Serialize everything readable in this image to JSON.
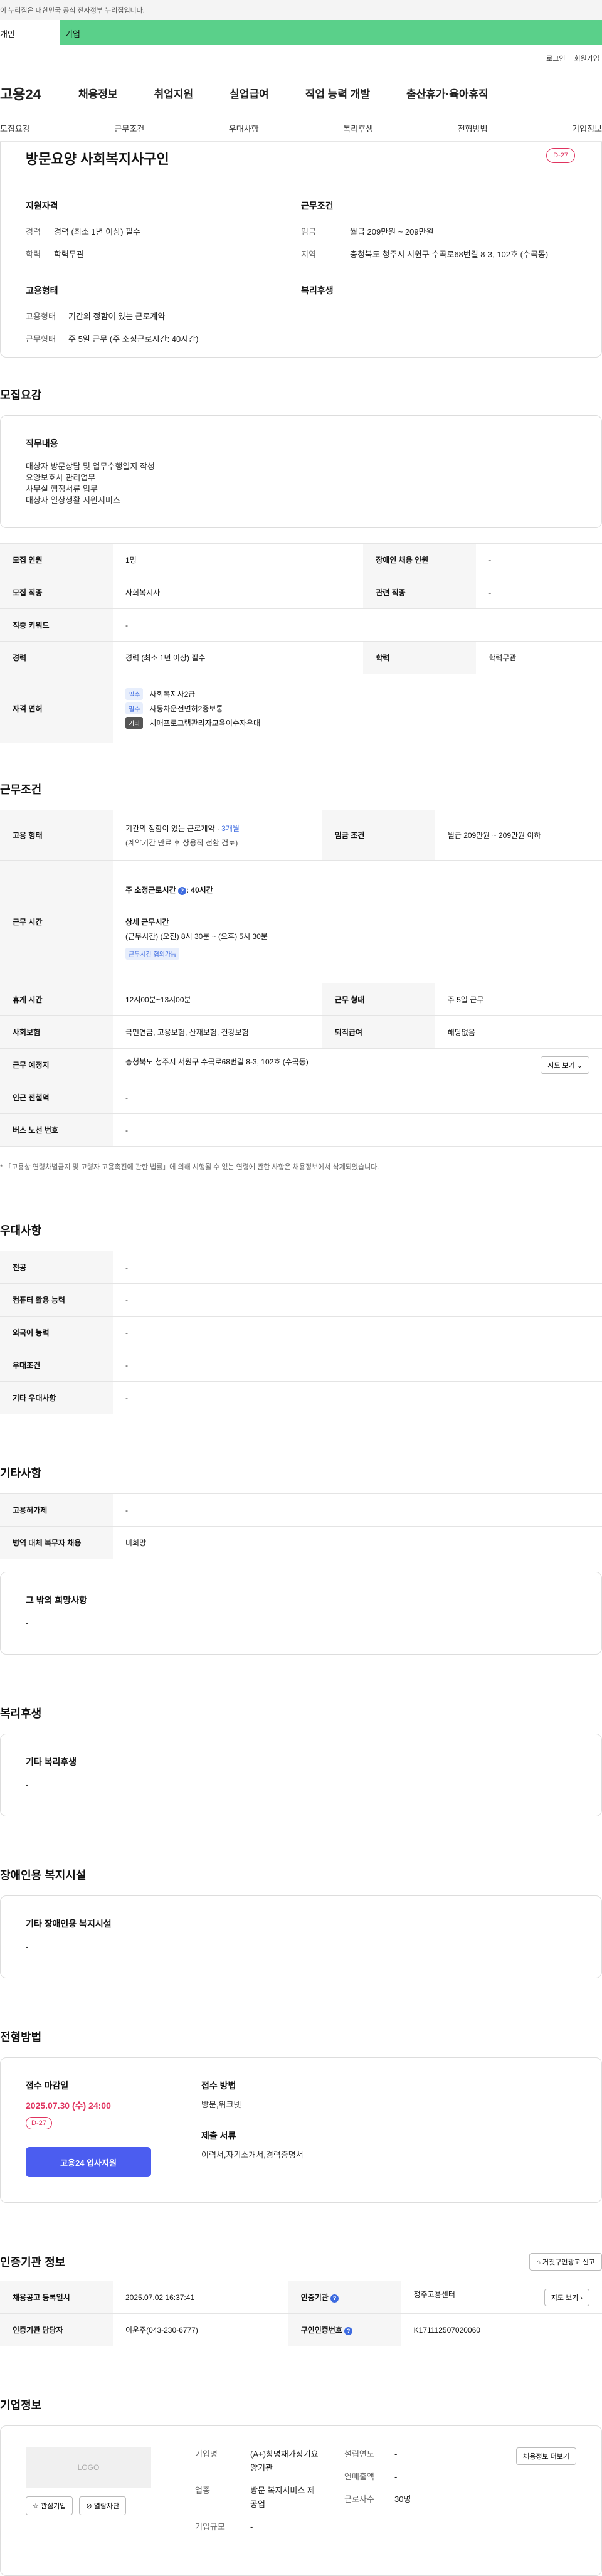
{
  "gov_banner": "이 누리집은 대한민국 공식 전자정부 누리집입니다.",
  "audience_tabs": [
    "개인",
    "기업"
  ],
  "util_links": [
    "로그인",
    "회원가입"
  ],
  "logo": "고용24",
  "gnb": [
    "채용정보",
    "취업지원",
    "실업급여",
    "직업 능력 개발",
    "출산휴가·육아휴직"
  ],
  "anchor_tabs": [
    "모집요강",
    "근무조건",
    "우대사항",
    "복리후생",
    "전형방법",
    "기업정보"
  ],
  "summary": {
    "title": "방문요양 사회복지사구인",
    "dday": "D-27",
    "qual_heading": "지원자격",
    "qual": [
      {
        "k": "경력",
        "v": "경력 (최소 1년 이상) 필수"
      },
      {
        "k": "학력",
        "v": "학력무관"
      }
    ],
    "cond_heading": "근무조건",
    "cond": [
      {
        "k": "임금",
        "v": "월급 209만원 ~ 209만원"
      },
      {
        "k": "지역",
        "v": "충청북도 청주시 서원구 수곡로68번길 8-3, 102호 (수곡동)"
      }
    ],
    "emp_heading": "고용형태",
    "emp": [
      {
        "k": "고용형태",
        "v": "기간의 정함이 있는 근로계약"
      },
      {
        "k": "근무형태",
        "v": "주 5일 근무 (주 소정근로시간: 40시간)"
      }
    ],
    "welfare_heading": "복리후생"
  },
  "recruit": {
    "heading": "모집요강",
    "duty_heading": "직무내용",
    "duty_lines": [
      "대상자 방문상담 및 업무수행일지 작성",
      "요양보호사 관리업무",
      "사무실 행정서류 업무",
      "대상자 일상생활 지원서비스"
    ],
    "rows": {
      "headcount_k": "모집 인원",
      "headcount_v": "1명",
      "disabled_k": "장애인 채용 인원",
      "disabled_v": "-",
      "job_k": "모집 직종",
      "job_v": "사회복지사",
      "related_k": "관련 직종",
      "related_v": "-",
      "keyword_k": "직종 키워드",
      "keyword_v": "-",
      "career_k": "경력",
      "career_v": "경력 (최소 1년 이상) 필수",
      "edu_k": "학력",
      "edu_v": "학력무관",
      "license_k": "자격 면허",
      "licenses": [
        {
          "tag": "필수",
          "name": "사회복지사2급"
        },
        {
          "tag": "필수",
          "name": "자동차운전면허2종보통"
        },
        {
          "tag": "기타",
          "name": "치매프로그램관리자교육이수자우대"
        }
      ]
    }
  },
  "work": {
    "heading": "근무조건",
    "emp_type_k": "고용 형태",
    "emp_type_v": "기간의 정함이 있는 근로계약 · ",
    "emp_type_months": "3개월",
    "emp_type_sub": "(계약기간 만료 후 상용직 전환 검토)",
    "wage_k": "임금 조건",
    "wage_v": "월급 209만원 ~ 209만원 이하",
    "hours_k": "근무 시간",
    "weekly_hours_label": "주 소정근로시간",
    "weekly_hours_value": ": 40시간",
    "detail_label": "상세 근무시간",
    "detail_value": "(근무시간) (오전) 8시 30분 ~ (오후) 5시 30분",
    "negotiable": "근무시간 협의가능",
    "break_k": "휴게 시간",
    "break_v": "12시00분~13시00분",
    "shift_k": "근무 형태",
    "shift_v": "주 5일 근무",
    "insurance_k": "사회보험",
    "insurance_v": "국민연금, 고용보험, 산재보험, 건강보험",
    "severance_k": "퇴직급여",
    "severance_v": "해당없음",
    "place_k": "근무 예정지",
    "place_v": "충청북도 청주시 서원구 수곡로68번길 8-3, 102호 (수곡동)",
    "map_btn": "지도 보기",
    "subway_k": "인근 전철역",
    "subway_v": "-",
    "bus_k": "버스 노선 번호",
    "bus_v": "-",
    "note": "* 「고용상 연령차별금지 및 고령자 고용촉진에 관한 법률」에 의해 시행될 수 없는 연령에 관한 사항은 채용정보에서 삭제되었습니다."
  },
  "prefer": {
    "heading": "우대사항",
    "rows": [
      {
        "k": "전공",
        "v": "-"
      },
      {
        "k": "컴퓨터 활용 능력",
        "v": "-"
      },
      {
        "k": "외국어 능력",
        "v": "-"
      },
      {
        "k": "우대조건",
        "v": "-"
      },
      {
        "k": "기타 우대사항",
        "v": "-"
      }
    ]
  },
  "etc": {
    "heading": "기타사항",
    "rows": [
      {
        "k": "고용허가제",
        "v": "-"
      },
      {
        "k": "병역 대체 복무자 채용",
        "v": "비희망"
      }
    ],
    "other_heading": "그 밖의 희망사항",
    "other_value": "-"
  },
  "welfare": {
    "heading": "복리후생",
    "box_heading": "기타 복리후생",
    "box_value": "-"
  },
  "disability": {
    "heading": "장애인용 복지시설",
    "box_heading": "기타 장애인용 복지시설",
    "box_value": "-"
  },
  "selection": {
    "heading": "전형방법",
    "deadline_label": "접수 마감일",
    "deadline": "2025.07.30 (수) 24:00",
    "dday": "D-27",
    "apply_btn": "고용24 입사지원",
    "method_label": "접수 방법",
    "method": "방문,워크넷",
    "docs_label": "제출 서류",
    "docs": "이력서,자기소개서,경력증명서"
  },
  "cert": {
    "heading": "인증기관 정보",
    "report_btn": "거짓구인광고 신고",
    "reg_date_k": "채용공고 등록일시",
    "reg_date_v": "2025.07.02 16:37:41",
    "agency_k": "인증기관",
    "agency_v": "청주고용센터",
    "map_btn": "지도 보기",
    "contact_k": "인증기관 담당자",
    "contact_v": "이운주(043-230-6777)",
    "job_no_k": "구인인증번호",
    "job_no_v": "K171112507020060"
  },
  "company": {
    "heading": "기업정보",
    "logo_text": "LOGO",
    "interest_btn": "관심기업",
    "block_btn": "열람차단",
    "name_k": "기업명",
    "name_v": "(A+)창명재가장기요양기관",
    "founded_k": "설립연도",
    "founded_v": "-",
    "sales_k": "연매출액",
    "sales_v": "-",
    "industry_k": "업종",
    "industry_v": "방문 복지서비스 제공업",
    "employees_k": "근로자수",
    "employees_v": "30명",
    "size_k": "기업규모",
    "size_v": "-",
    "hiring_btn": "채용정보 더보기"
  },
  "colors": {
    "accent_green": "#5ad08a",
    "dday_red": "#e0335f",
    "apply_blue": "#4b5df0",
    "info_blue": "#3d6be0"
  }
}
